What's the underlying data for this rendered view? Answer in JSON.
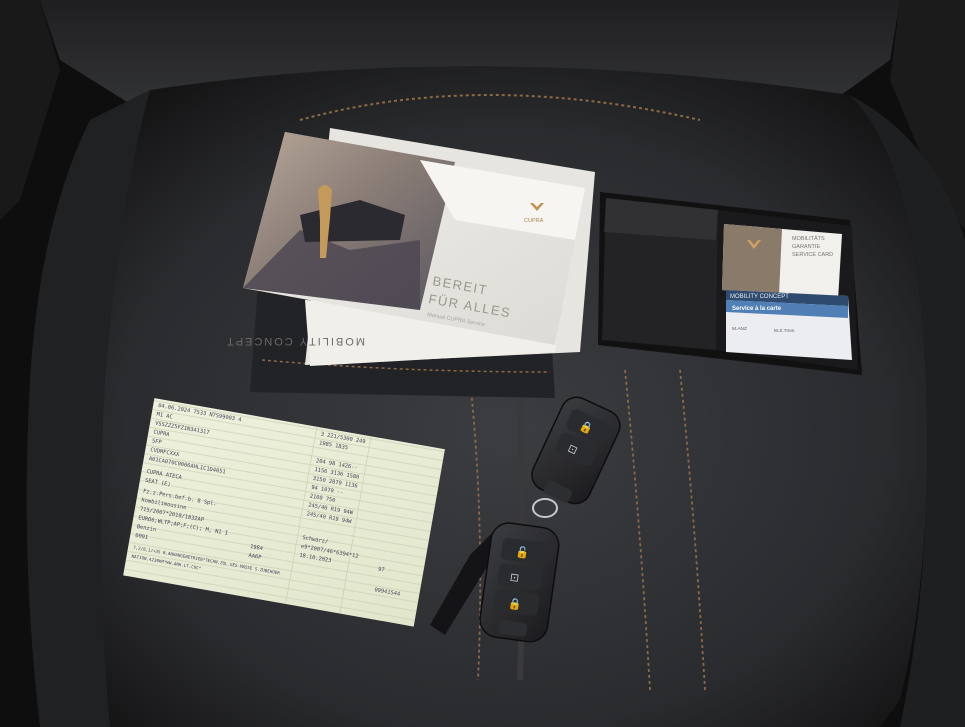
{
  "brochure": {
    "brand": "CUPRA",
    "headline_line1": "BEREIT",
    "headline_line2": "FÜR ALLES",
    "subline": "Manual CUPRA Service"
  },
  "pocket_booklet": {
    "label": "MOBILITY CONCEPT"
  },
  "wallet": {
    "garantie_card": {
      "line1": "MOBILITÄTS",
      "line2": "GARANTIE",
      "line3": "SERVICE CARD"
    },
    "mobility_card": {
      "title": "MOBILITY CONCEPT",
      "subtitle": "Service à la carte",
      "field1": "M.ANZ",
      "field2": "M.Z.Tmm"
    }
  },
  "registration_doc": {
    "lines": [
      "04.06.2024    7533   N7599003 4",
      "M1                 AC",
      "VSSZZZ5FZ1N341317",
      "CUPRA",
      "5FP",
      "CVDMFCXXX",
      "A01CA070C0006AHLIC1D4051",
      "CUPRA ATECA",
      "SEAT (E)",
      "Fz.z.Pers.bef.b. 8 Spl.",
      "Kombilimousine",
      "715/2007*2018/1832AP",
      "EURO6;WLTP;AP;F;(C); M, N1 I",
      "Benzin",
      "0001",
      "7,2/8,1/+35 B.ANHANGEBETRIEB*TECHN.ZUL.GES-MASSE S.ZUBEHOER",
      "NATION.4230KM*WW.ANH.LT.COC*"
    ],
    "right_lines": [
      "3     221/5300  249",
      "1985        1835",
      "204    98    1426--",
      "1156   3136   1580",
      "3150   2870   1136",
      "94     1070   --",
      "2100   750",
      "245/40 R19 94W",
      "245/40 R19 94W",
      "Schwarz/",
      "e9*2007/46*6394*12",
      "18.10.2023",
      "97",
      "09941544"
    ],
    "extra_lines": [
      "1984",
      "AA6P",
      "7,2/8,1/+35 ..."
    ]
  }
}
